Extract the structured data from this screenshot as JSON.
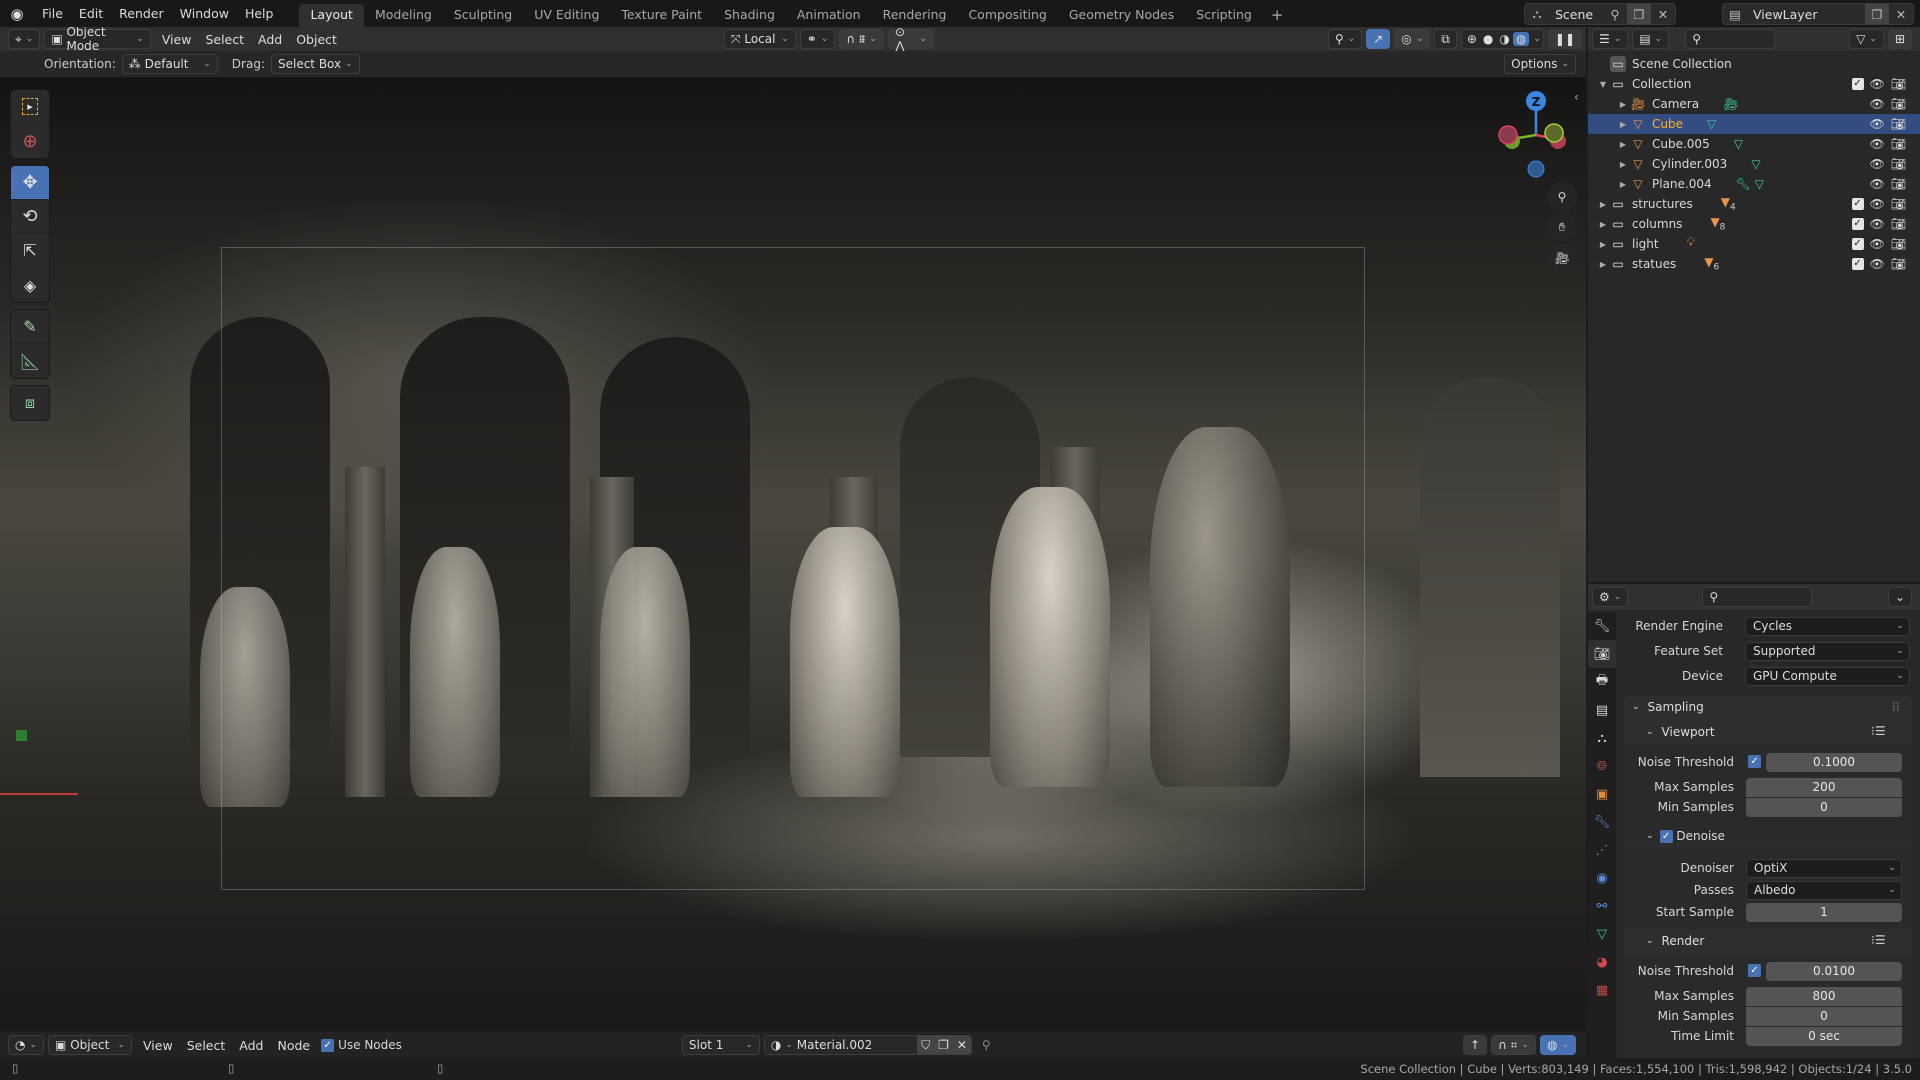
{
  "topbar": {
    "menus": [
      "File",
      "Edit",
      "Render",
      "Window",
      "Help"
    ],
    "workspaces": [
      "Layout",
      "Modeling",
      "Sculpting",
      "UV Editing",
      "Texture Paint",
      "Shading",
      "Animation",
      "Rendering",
      "Compositing",
      "Geometry Nodes",
      "Scripting"
    ],
    "active_workspace": "Layout",
    "scene": "Scene",
    "view_layer": "ViewLayer"
  },
  "viewport": {
    "mode": "Object Mode",
    "menus": [
      "View",
      "Select",
      "Add",
      "Object"
    ],
    "transform_orientation": "Local",
    "orientation_label": "Orientation:",
    "orientation_value": "Default",
    "drag_label": "Drag:",
    "drag_value": "Select Box",
    "options_label": "Options",
    "gizmo_axis": "Z",
    "tools": [
      "Select Box",
      "Cursor",
      "Move",
      "Rotate",
      "Scale",
      "Transform",
      "Annotate",
      "Measure",
      "Add Cube"
    ],
    "active_tool": "Move"
  },
  "outliner": {
    "root": "Scene Collection",
    "rows": [
      {
        "name": "Collection",
        "type": "collection",
        "level": 1,
        "expanded": true,
        "checkbox": true
      },
      {
        "name": "Camera",
        "type": "camera",
        "level": 2,
        "data": "camera-data"
      },
      {
        "name": "Cube",
        "type": "mesh",
        "level": 2,
        "selected": true,
        "data": "mesh-data"
      },
      {
        "name": "Cube.005",
        "type": "mesh",
        "level": 2,
        "data": "mesh-data"
      },
      {
        "name": "Cylinder.003",
        "type": "mesh",
        "level": 2,
        "data": "mesh-data"
      },
      {
        "name": "Plane.004",
        "type": "mesh",
        "level": 2,
        "data": "mesh-data",
        "modifier": true
      },
      {
        "name": "structures",
        "type": "collection",
        "level": 1,
        "checkbox": true,
        "count": "4"
      },
      {
        "name": "columns",
        "type": "collection",
        "level": 1,
        "checkbox": true,
        "count": "8"
      },
      {
        "name": "light",
        "type": "collection",
        "level": 1,
        "checkbox": true,
        "count": ""
      },
      {
        "name": "statues",
        "type": "collection",
        "level": 1,
        "checkbox": true,
        "count": "6"
      }
    ]
  },
  "properties": {
    "render_engine_label": "Render Engine",
    "render_engine": "Cycles",
    "feature_set_label": "Feature Set",
    "feature_set": "Supported",
    "device_label": "Device",
    "device": "GPU Compute",
    "sampling": "Sampling",
    "viewport": {
      "title": "Viewport",
      "noise_threshold_label": "Noise Threshold",
      "noise_threshold": "0.1000",
      "noise_threshold_enabled": true,
      "max_samples_label": "Max Samples",
      "max_samples": "200",
      "min_samples_label": "Min Samples",
      "min_samples": "0"
    },
    "denoise": {
      "title": "Denoise",
      "enabled": true,
      "denoiser_label": "Denoiser",
      "denoiser": "OptiX",
      "passes_label": "Passes",
      "passes": "Albedo",
      "start_sample_label": "Start Sample",
      "start_sample": "1"
    },
    "render": {
      "title": "Render",
      "noise_threshold_label": "Noise Threshold",
      "noise_threshold": "0.0100",
      "noise_threshold_enabled": true,
      "max_samples_label": "Max Samples",
      "max_samples": "800",
      "min_samples_label": "Min Samples",
      "min_samples": "0",
      "time_limit_label": "Time Limit",
      "time_limit": "0 sec"
    }
  },
  "node_editor": {
    "type": "Object",
    "menus": [
      "View",
      "Select",
      "Add",
      "Node"
    ],
    "use_nodes_label": "Use Nodes",
    "use_nodes": true,
    "slot": "Slot 1",
    "material": "Material.002"
  },
  "statusbar": {
    "text": "Scene Collection | Cube | Verts:803,149 | Faces:1,554,100 | Tris:1,598,942 | Objects:1/24 | 3.5.0"
  }
}
